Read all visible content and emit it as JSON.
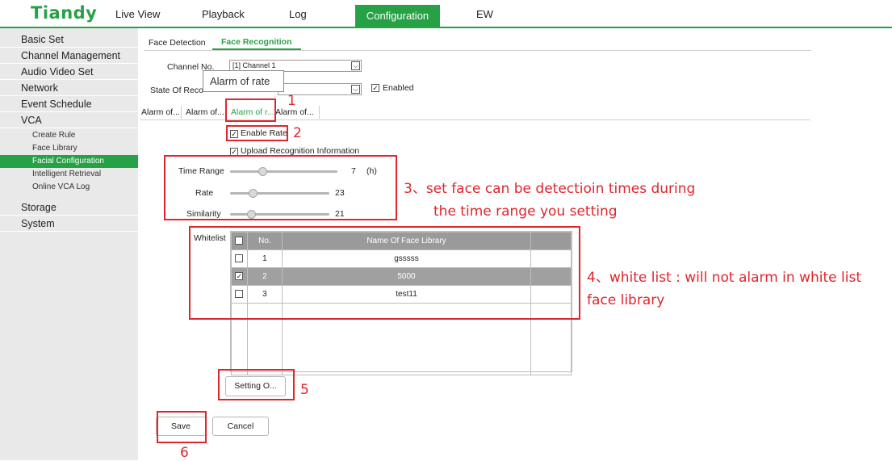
{
  "brand": {
    "logo": "Tiandy",
    "accent": "#27a146",
    "annotation_color": "#e0252c"
  },
  "nav": {
    "items": [
      "Live View",
      "Playback",
      "Log",
      "Configuration",
      "EW"
    ],
    "active": "Configuration"
  },
  "sidebar": {
    "items": [
      "Basic Set",
      "Channel Management",
      "Audio Video Set",
      "Network",
      "Event Schedule",
      "VCA"
    ],
    "vca_sub": [
      "Create Rule",
      "Face Library",
      "Facial Configuration",
      "Intelligent Retrieval",
      "Online VCA Log"
    ],
    "active_sub": "Facial Configuration",
    "bottom_items": [
      "Storage",
      "System"
    ]
  },
  "tabs": {
    "face_detection": "Face Detection",
    "face_recognition": "Face Recognition"
  },
  "form": {
    "channel_label": "Channel No.",
    "channel_value": "[1] Channel 1",
    "state_label": "State Of Reco",
    "enabled_label": "Enabled",
    "tooltip": "Alarm of rate"
  },
  "subtabs": [
    "Alarm of...",
    "Alarm of...",
    "Alarm of r...",
    "Alarm of..."
  ],
  "options": {
    "enable_rate": "Enable Rate",
    "upload_info": "Upload Recognition Information"
  },
  "sliders": {
    "time_range": {
      "label": "Time Range",
      "value": "7",
      "unit": "(h)",
      "fill": 0.3
    },
    "rate": {
      "label": "Rate",
      "value": "23",
      "fill": 0.23
    },
    "similarity": {
      "label": "Similarity",
      "value": "21",
      "fill": 0.21
    }
  },
  "whitelist": {
    "label": "Whitelist",
    "col_no": "No.",
    "col_name": "Name Of Face Library",
    "rows": [
      {
        "no": "1",
        "name": "gsssss",
        "checked": false
      },
      {
        "no": "2",
        "name": "5000",
        "checked": true
      },
      {
        "no": "3",
        "name": "test11",
        "checked": false
      }
    ]
  },
  "buttons": {
    "setting": "Setting O...",
    "save": "Save",
    "cancel": "Cancel"
  },
  "annotations": {
    "n1": "1",
    "n2": "2",
    "n3": "3、set face can be detectioin times during",
    "n3b": "the time range you setting",
    "n4": "4、white list : will not alarm in white list",
    "n4b": "face library",
    "n5": "5",
    "n6": "6"
  }
}
